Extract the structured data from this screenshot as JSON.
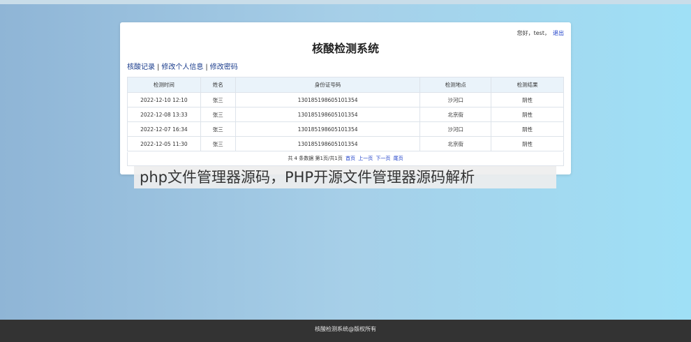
{
  "header": {
    "greeting": "您好，test，",
    "logout": "退出",
    "title": "核酸检测系统"
  },
  "nav": {
    "items": [
      "核酸记录",
      "修改个人信息",
      "修改密码"
    ],
    "separator": "|"
  },
  "table": {
    "columns": [
      "检测时间",
      "姓名",
      "身份证号码",
      "检测地点",
      "检测结果"
    ],
    "rows": [
      [
        "2022-12-10 12:10",
        "张三",
        "130185198605101354",
        "沙河口",
        "阴性"
      ],
      [
        "2022-12-08 13:33",
        "张三",
        "130185198605101354",
        "北京街",
        "阴性"
      ],
      [
        "2022-12-07 16:34",
        "张三",
        "130185198605101354",
        "沙河口",
        "阴性"
      ],
      [
        "2022-12-05 11:30",
        "张三",
        "130185198605101354",
        "北京街",
        "阴性"
      ]
    ]
  },
  "pagination": {
    "summary": "共 4 条数据 第1页/共1页",
    "first": "首页",
    "prev": "上一页",
    "next": "下一页",
    "last": "尾页"
  },
  "caption": "php文件管理器源码，PHP开源文件管理器源码解析",
  "footer": "核酸检测系统@版权所有",
  "colors": {
    "link": "#1a3cc8",
    "header_bg": "#eaf3fa",
    "footer_bg": "#333333"
  }
}
